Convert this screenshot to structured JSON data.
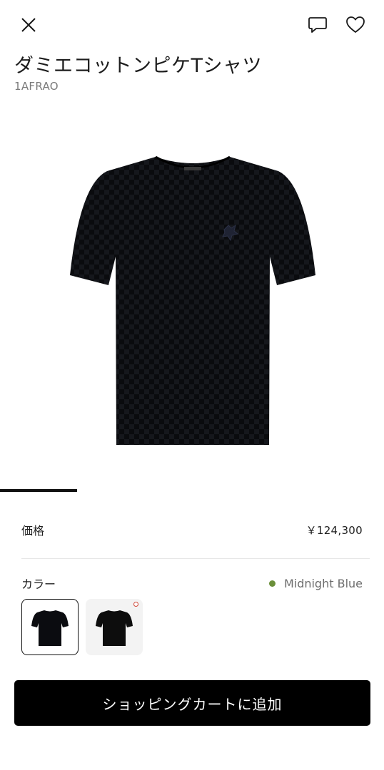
{
  "header": {
    "close_icon": "close-icon",
    "chat_icon": "chat-bubble-icon",
    "favorite_icon": "heart-icon"
  },
  "product": {
    "title": "ダミエコットンピケTシャツ",
    "sku": "1AFRAO",
    "image": "black-tshirt-image"
  },
  "gallery": {
    "progress": 0.2
  },
  "price": {
    "label": "価格",
    "value": "￥124,300"
  },
  "color": {
    "label": "カラー",
    "selected_name": "Midnight Blue",
    "selected_dot_color": "#6b8f3a",
    "swatches": [
      {
        "selected": true,
        "new_badge": false
      },
      {
        "selected": false,
        "new_badge": true
      }
    ]
  },
  "cart": {
    "button_label": "ショッピングカートに追加"
  },
  "colors": {
    "button_bg": "#000000",
    "badge": "#d24a3b"
  }
}
